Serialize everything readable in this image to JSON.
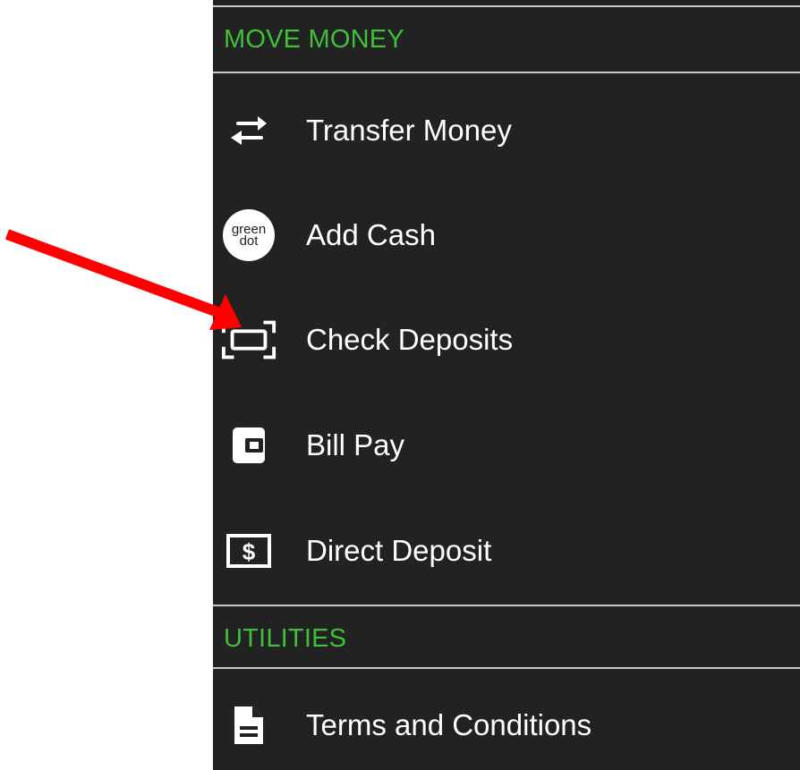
{
  "sections": {
    "move_money": {
      "header": "MOVE MONEY",
      "items": [
        {
          "label": "Transfer Money",
          "icon": "transfer-arrows-icon"
        },
        {
          "label": "Add Cash",
          "icon": "green-dot-logo-icon"
        },
        {
          "label": "Check Deposits",
          "icon": "check-scan-icon"
        },
        {
          "label": "Bill Pay",
          "icon": "wallet-icon"
        },
        {
          "label": "Direct Deposit",
          "icon": "dollar-bill-icon"
        }
      ]
    },
    "utilities": {
      "header": "UTILITIES",
      "items": [
        {
          "label": "Terms and Conditions",
          "icon": "document-icon"
        }
      ]
    }
  },
  "add_cash_badge": {
    "line1": "green",
    "line2": "dot"
  },
  "bill_symbol": "$",
  "colors": {
    "panel_background": "#222222",
    "section_header": "#3fbf3a",
    "item_text": "#ffffff",
    "divider": "#c9c9c9",
    "annotation_arrow": "#ff0000"
  }
}
